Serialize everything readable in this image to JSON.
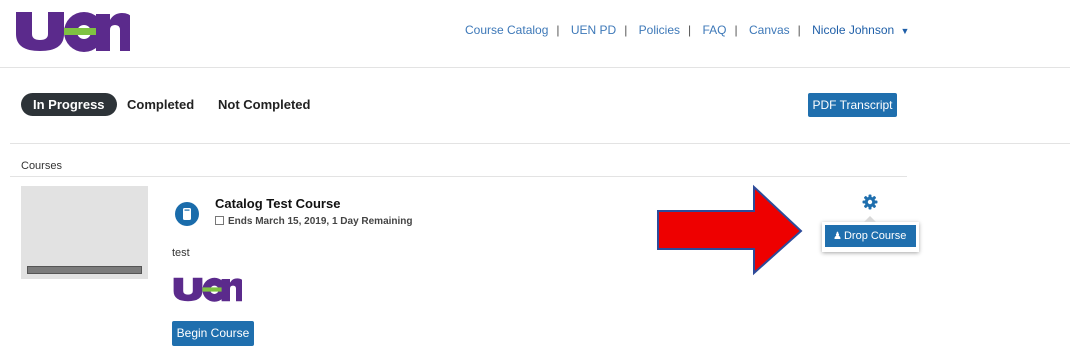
{
  "logo": {
    "text": "uen"
  },
  "nav": {
    "links": [
      "Course Catalog",
      "UEN PD",
      "Policies",
      "FAQ",
      "Canvas"
    ],
    "user_name": "Nicole Johnson"
  },
  "tabs": [
    "In Progress",
    "Completed",
    "Not Completed"
  ],
  "pdf_transcript_label": "PDF Transcript",
  "section_title": "Courses",
  "course": {
    "title": "Catalog Test Course",
    "end_info": "Ends March 15, 2019, 1 Day Remaining",
    "description": "test",
    "begin_label": "Begin Course",
    "drop_label": "Drop Course",
    "progress": 0
  },
  "colors": {
    "logo_purple": "#5b2a8c",
    "logo_green": "#7fc242",
    "nav_blue": "#3d78b8",
    "primary_blue": "#1f6fae",
    "arrow_red": "#ee0000",
    "arrow_outline": "#2d4b9a"
  },
  "icons": [
    "calendar-icon",
    "book-icon",
    "gear-icon",
    "user-plus-icon",
    "caret-down-icon"
  ]
}
